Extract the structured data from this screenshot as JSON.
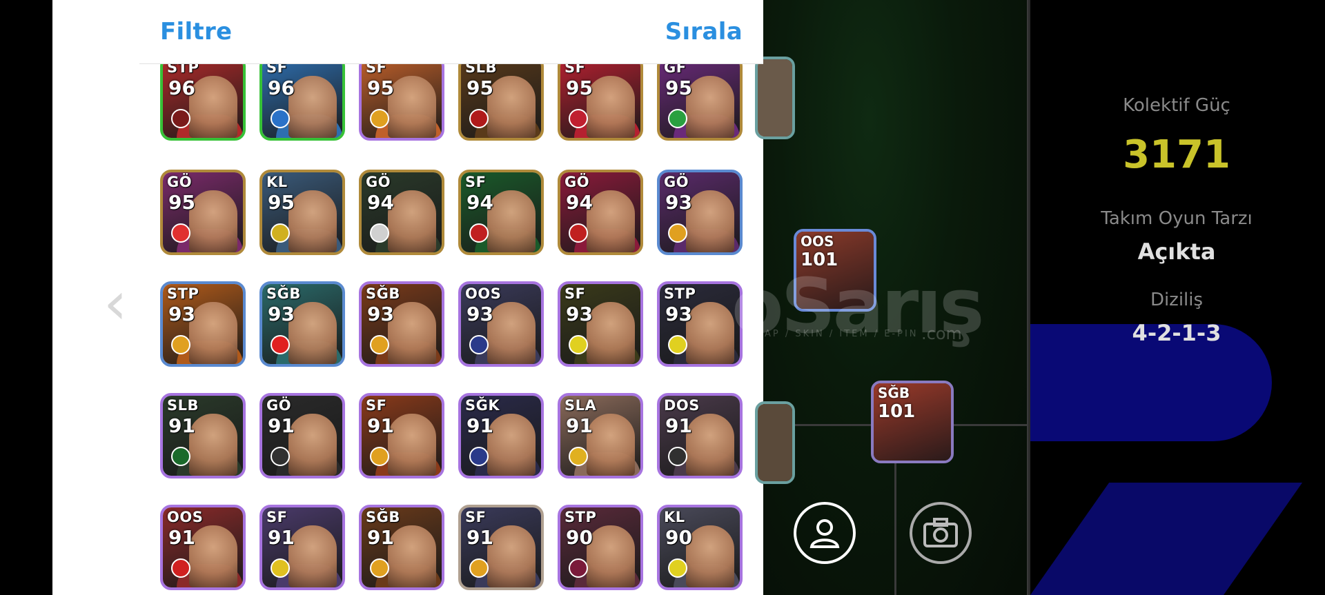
{
  "header": {
    "filter_label": "Filtre",
    "sort_label": "Sırala"
  },
  "players": [
    {
      "pos": "STP",
      "ovr": "96",
      "bg": "#b02a2a",
      "frame": "#37c237",
      "badge": "#7a1b1b"
    },
    {
      "pos": "SF",
      "ovr": "96",
      "bg": "#2e6fb0",
      "frame": "#37c237",
      "badge": "#2a72c8"
    },
    {
      "pos": "SF",
      "ovr": "95",
      "bg": "#c0602a",
      "frame": "#a774e0",
      "badge": "#e0a020"
    },
    {
      "pos": "SLB",
      "ovr": "95",
      "bg": "#5a3a1a",
      "frame": "#b08a3a",
      "badge": "#b01a1a"
    },
    {
      "pos": "SF",
      "ovr": "95",
      "bg": "#b52030",
      "frame": "#b08a3a",
      "badge": "#c02030"
    },
    {
      "pos": "GF",
      "ovr": "95",
      "bg": "#6a2a7a",
      "frame": "#b08a3a",
      "badge": "#2aa040"
    },
    {
      "pos": "GÖ",
      "ovr": "95",
      "bg": "#7a2a6a",
      "frame": "#b08a3a",
      "badge": "#e03030"
    },
    {
      "pos": "KL",
      "ovr": "95",
      "bg": "#3a5a7a",
      "frame": "#b08a3a",
      "badge": "#d0b020"
    },
    {
      "pos": "GÖ",
      "ovr": "94",
      "bg": "#2a3a2a",
      "frame": "#b08a3a",
      "badge": "#d0d0d0"
    },
    {
      "pos": "SF",
      "ovr": "94",
      "bg": "#1a5a2a",
      "frame": "#b08a3a",
      "badge": "#c02020"
    },
    {
      "pos": "GÖ",
      "ovr": "94",
      "bg": "#8a1a3a",
      "frame": "#b08a3a",
      "badge": "#c02020"
    },
    {
      "pos": "GÖ",
      "ovr": "93",
      "bg": "#5a2a6a",
      "frame": "#5a8ad0",
      "badge": "#e0a020"
    },
    {
      "pos": "STP",
      "ovr": "93",
      "bg": "#b05a1a",
      "frame": "#5a8ad0",
      "badge": "#e0a020"
    },
    {
      "pos": "SĞB",
      "ovr": "93",
      "bg": "#2a6a6a",
      "frame": "#5a8ad0",
      "badge": "#e02020"
    },
    {
      "pos": "SĞB",
      "ovr": "93",
      "bg": "#7a3a1a",
      "frame": "#a774e0",
      "badge": "#e0a020"
    },
    {
      "pos": "OOS",
      "ovr": "93",
      "bg": "#3a3a5a",
      "frame": "#a774e0",
      "badge": "#2a3a8a"
    },
    {
      "pos": "SF",
      "ovr": "93",
      "bg": "#3a3a1a",
      "frame": "#a774e0",
      "badge": "#e0d020"
    },
    {
      "pos": "STP",
      "ovr": "93",
      "bg": "#2a2a3a",
      "frame": "#a774e0",
      "badge": "#e0d020"
    },
    {
      "pos": "SLB",
      "ovr": "91",
      "bg": "#2a3a2a",
      "frame": "#a774e0",
      "badge": "#1a6a2a"
    },
    {
      "pos": "GÖ",
      "ovr": "91",
      "bg": "#2a2a2a",
      "frame": "#a774e0",
      "badge": "#303030"
    },
    {
      "pos": "SF",
      "ovr": "91",
      "bg": "#8a3a1a",
      "frame": "#a774e0",
      "badge": "#e0a020"
    },
    {
      "pos": "SĞK",
      "ovr": "91",
      "bg": "#2a2a4a",
      "frame": "#a774e0",
      "badge": "#2a3a8a"
    },
    {
      "pos": "SLA",
      "ovr": "91",
      "bg": "#8a6a5a",
      "frame": "#a774e0",
      "badge": "#e0b020"
    },
    {
      "pos": "DOS",
      "ovr": "91",
      "bg": "#4a3a4a",
      "frame": "#a774e0",
      "badge": "#303030"
    },
    {
      "pos": "OOS",
      "ovr": "91",
      "bg": "#8a2a2a",
      "frame": "#a774e0",
      "badge": "#d02020"
    },
    {
      "pos": "SF",
      "ovr": "91",
      "bg": "#4a3a6a",
      "frame": "#a774e0",
      "badge": "#e0c020"
    },
    {
      "pos": "SĞB",
      "ovr": "91",
      "bg": "#6a3a1a",
      "frame": "#a774e0",
      "badge": "#e0a020"
    },
    {
      "pos": "SF",
      "ovr": "91",
      "bg": "#3a3a5a",
      "frame": "#b0a090",
      "badge": "#e0a020"
    },
    {
      "pos": "STP",
      "ovr": "90",
      "bg": "#5a2a3a",
      "frame": "#a774e0",
      "badge": "#7a1a3a"
    },
    {
      "pos": "KL",
      "ovr": "90",
      "bg": "#4a4a5a",
      "frame": "#a774e0",
      "badge": "#e0d020"
    }
  ],
  "pitch_players": [
    {
      "pos": "OOS",
      "ovr": "101",
      "bg": "#8a3a2a",
      "frame": "#6a8ad8"
    },
    {
      "pos": "SĞB",
      "ovr": "101",
      "bg": "#9a3a2a",
      "frame": "#8a7ac0"
    }
  ],
  "team_info": {
    "power_label": "Kolektif Güç",
    "power_value": "3171",
    "play_style_label": "Takım Oyun Tarzı",
    "play_style_value": "Açıkta",
    "formation_label": "Diziliş",
    "formation_value": "4-2-1-3"
  },
  "watermark": {
    "main": "oSarış",
    "sub": "AP / SKIN / ITEM / E-PIN",
    "com": ".com"
  },
  "icons": {
    "back": "chevron-left-icon",
    "profile": "person-icon",
    "camera": "camera-icon"
  }
}
